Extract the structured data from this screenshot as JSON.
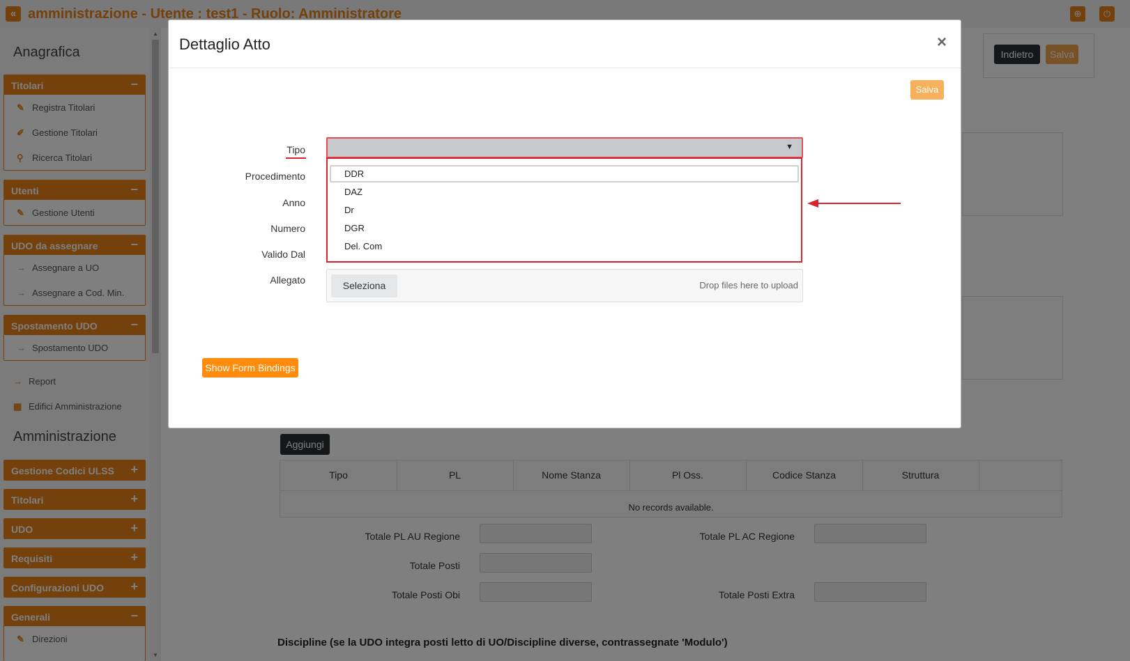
{
  "header": {
    "title": "amministrazione - Utente : test1 - Ruolo: Amministratore",
    "back_icon": "«",
    "globe_icon": "⊕",
    "power_icon": "⏻"
  },
  "sidebar": {
    "section_anagrafica": "Anagrafica",
    "section_amministrazione": "Amministrazione",
    "panels": [
      {
        "title": "Titolari",
        "toggle": "−",
        "items": [
          "Registra Titolari",
          "Gestione Titolari",
          "Ricerca Titolari"
        ]
      },
      {
        "title": "Utenti",
        "toggle": "−",
        "items": [
          "Gestione Utenti"
        ]
      },
      {
        "title": "UDO da assegnare",
        "toggle": "−",
        "items": [
          "Assegnare a UO",
          "Assegnare a Cod. Min."
        ]
      },
      {
        "title": "Spostamento UDO",
        "toggle": "−",
        "items": [
          "Spostamento UDO"
        ]
      }
    ],
    "links": [
      "Report",
      "Edifici Amministrazione"
    ],
    "admin_panels": [
      {
        "title": "Gestione Codici ULSS",
        "toggle": "+"
      },
      {
        "title": "Titolari",
        "toggle": "+"
      },
      {
        "title": "UDO",
        "toggle": "+"
      },
      {
        "title": "Requisiti",
        "toggle": "+"
      },
      {
        "title": "Configurazioni UDO",
        "toggle": "+"
      },
      {
        "title": "Generali",
        "toggle": "−",
        "items": [
          "Direzioni"
        ]
      }
    ]
  },
  "page": {
    "indietro": "Indietro",
    "salva": "Salva",
    "aggiungi": "Aggiungi",
    "columns": [
      "Tipo",
      "PL",
      "Nome Stanza",
      "Pl Oss.",
      "Codice Stanza",
      "Struttura"
    ],
    "no_records": "No records available.",
    "totals": {
      "pl_au": "Totale PL AU Regione",
      "pl_ac": "Totale PL AC Regione",
      "posti": "Totale Posti",
      "posti_obi": "Totale Posti Obi",
      "posti_extra": "Totale Posti Extra"
    },
    "discipline_title": "Discipline (se la UDO integra posti letto di UO/Discipline diverse, contrassegnate 'Modulo')"
  },
  "modal": {
    "title": "Dettaglio Atto",
    "close": "×",
    "save": "Salva",
    "labels": {
      "tipo": "Tipo",
      "procedimento": "Procedimento",
      "anno": "Anno",
      "numero": "Numero",
      "valido_dal": "Valido Dal",
      "allegato": "Allegato"
    },
    "tipo_options": [
      "DDR",
      "DAZ",
      "Dr",
      "DGR",
      "Del. Com"
    ],
    "tipo_value": "",
    "upload_button": "Seleziona",
    "upload_hint": "Drop files here to upload",
    "bindings_button": "Show Form Bindings"
  },
  "colors": {
    "accent": "#e8821a",
    "highlight": "#d9232d"
  }
}
